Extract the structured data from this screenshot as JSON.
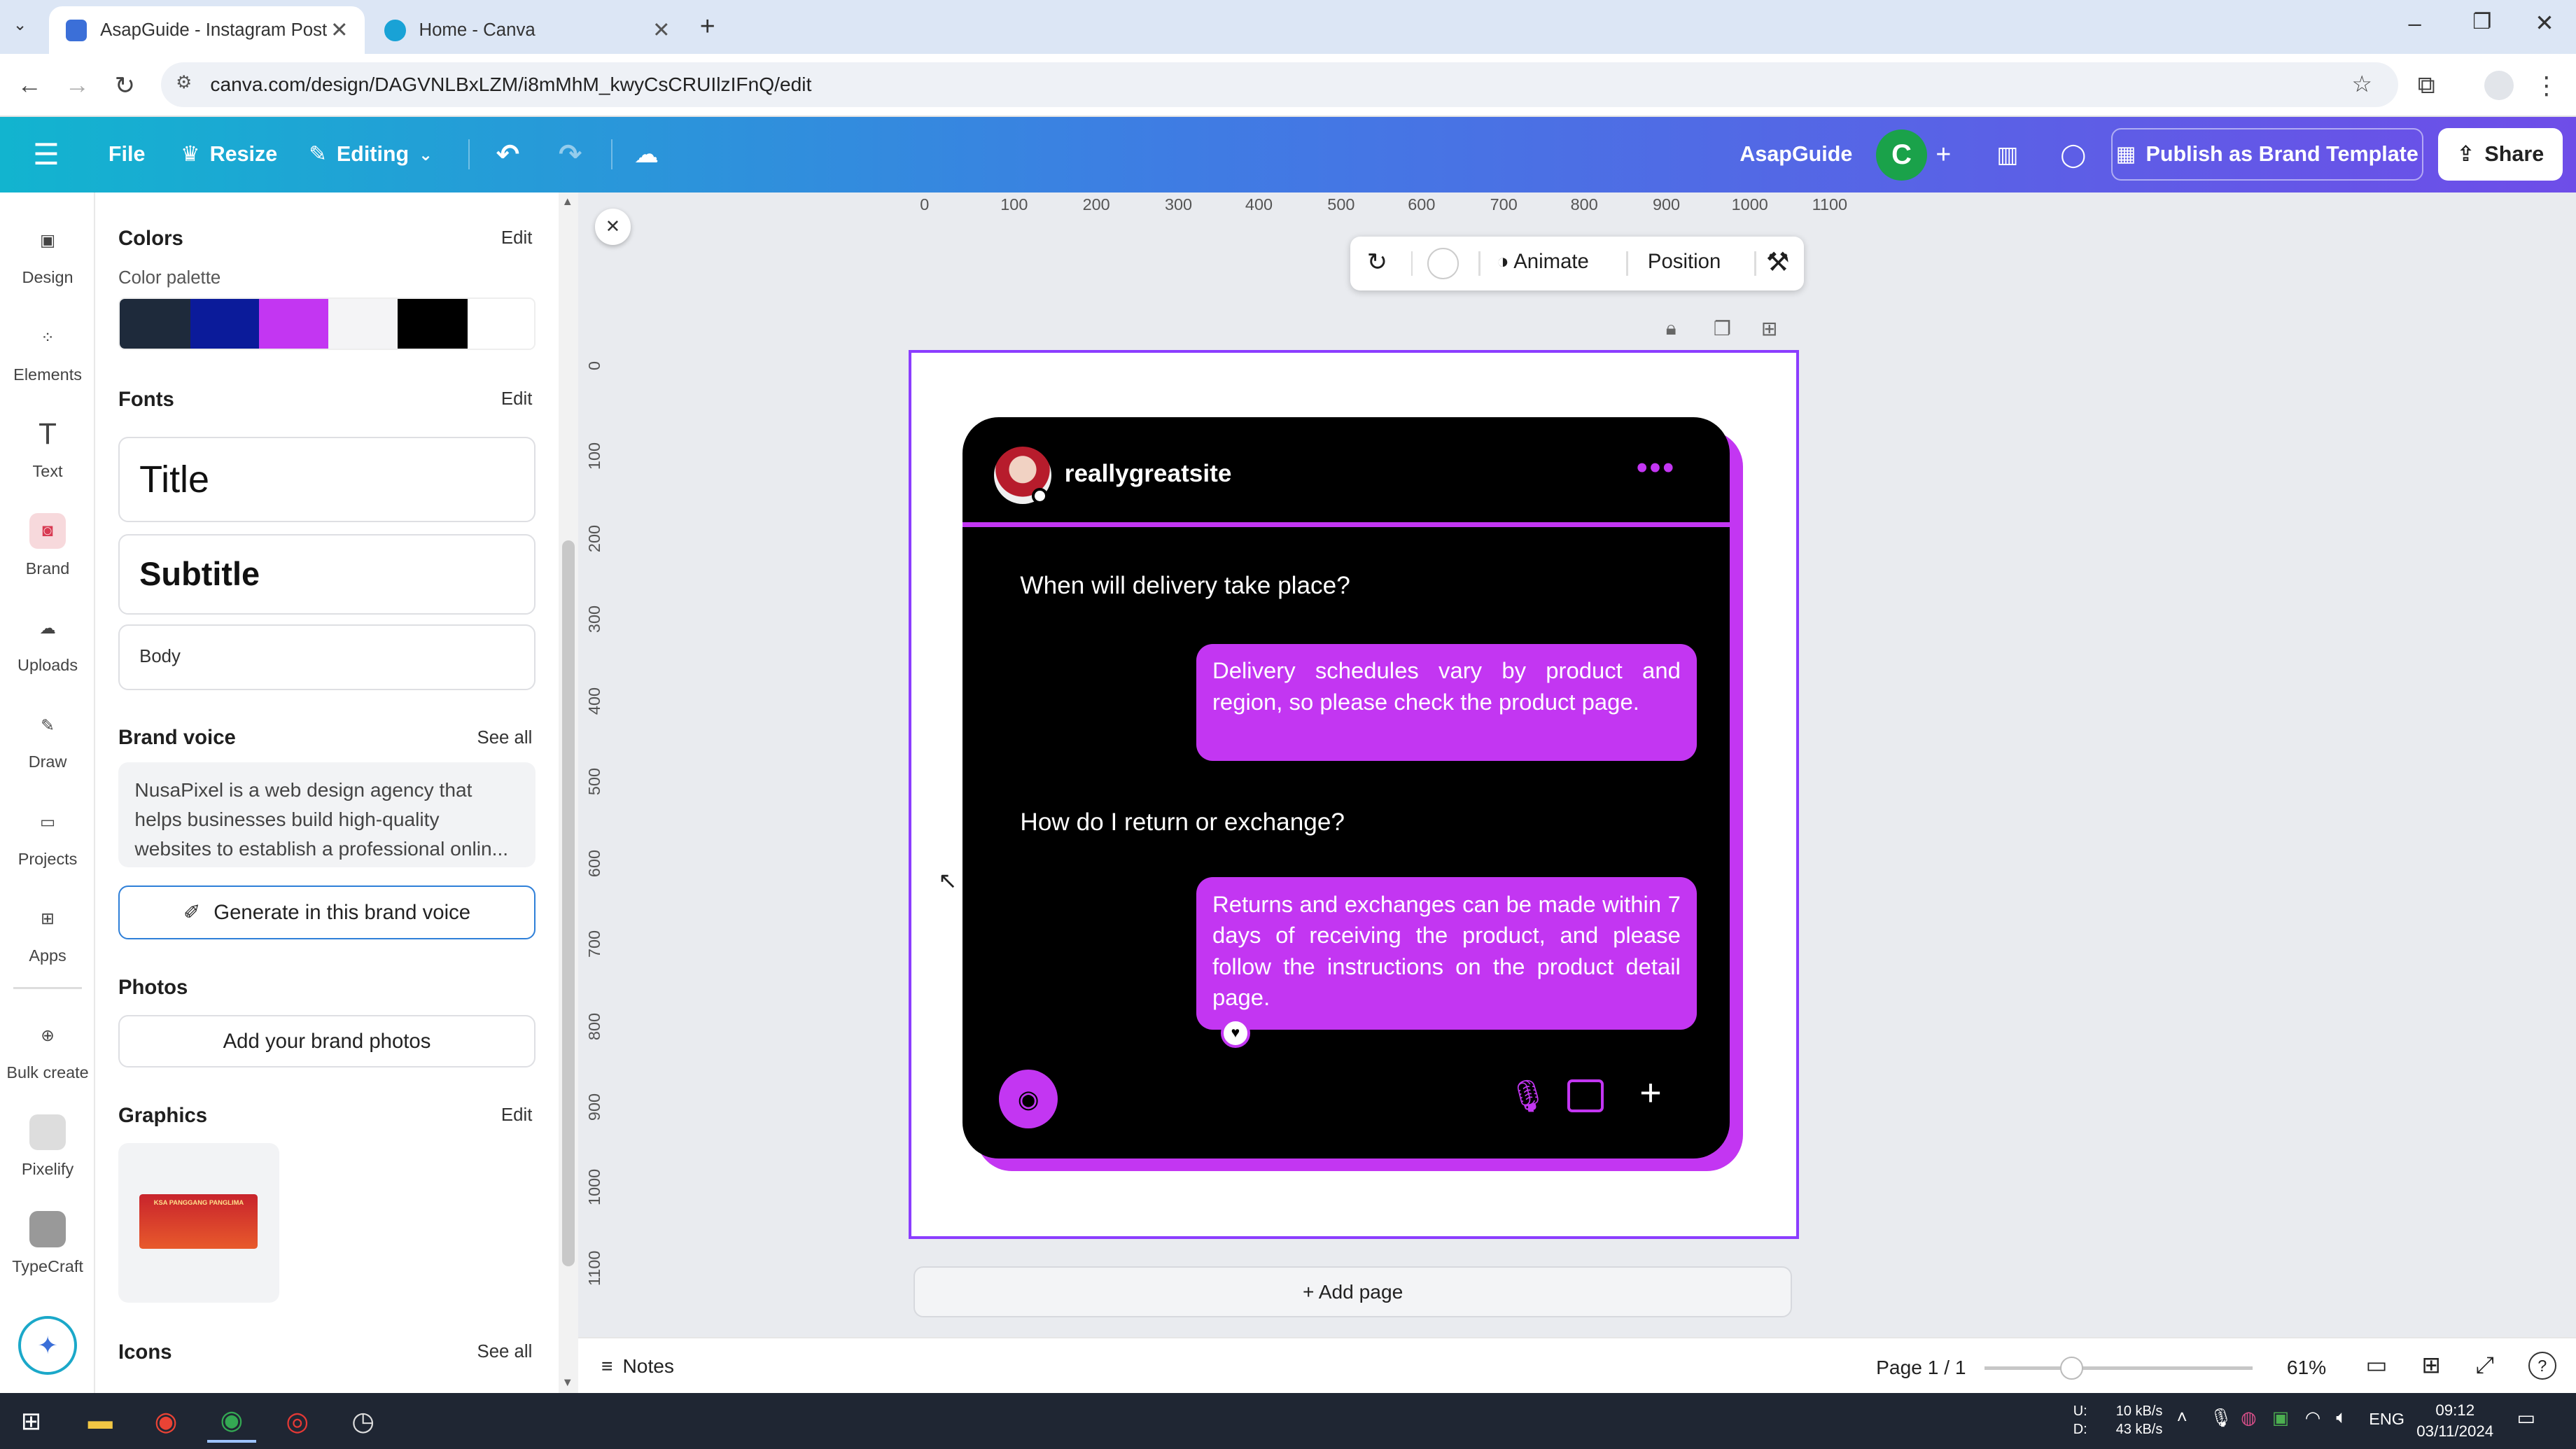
{
  "browser": {
    "tabs": [
      {
        "title": "AsapGuide - Instagram Post",
        "active": true
      },
      {
        "title": "Home - Canva",
        "active": false
      }
    ],
    "url": "canva.com/design/DAGVNLBxLZM/i8mMhM_kwyCsCRUIlzIFnQ/edit"
  },
  "header": {
    "file": "File",
    "resize": "Resize",
    "editing": "Editing",
    "team": "AsapGuide",
    "avatar_letter": "C",
    "publish": "Publish as Brand Template",
    "share": "Share"
  },
  "rail": [
    "Design",
    "Elements",
    "Text",
    "Brand",
    "Uploads",
    "Draw",
    "Projects",
    "Apps",
    "Bulk create",
    "Pixelify",
    "TypeCraft"
  ],
  "panel": {
    "colors_title": "Colors",
    "edit": "Edit",
    "palette_label": "Color palette",
    "palette": [
      "#1e2a3b",
      "#0b1b9a",
      "#c336f2",
      "#f4f4f6",
      "#000000",
      "#ffffff"
    ],
    "fonts_title": "Fonts",
    "font_title": "Title",
    "font_subtitle": "Subtitle",
    "font_body": "Body",
    "brand_voice_title": "Brand voice",
    "see_all": "See all",
    "brand_voice_text": "NusaPixel is a web design agency that helps businesses build high-quality websites to establish a professional onlin...",
    "generate": "Generate in this brand voice",
    "photos_title": "Photos",
    "add_photos": "Add your brand photos",
    "graphics_title": "Graphics",
    "graphic_text": "KSA PANGGANG PANGLIMA",
    "icons_title": "Icons"
  },
  "rulers": {
    "h": [
      "0",
      "100",
      "200",
      "300",
      "400",
      "500",
      "600",
      "700",
      "800",
      "900",
      "1000",
      "1100"
    ],
    "v": [
      "0",
      "100",
      "200",
      "300",
      "400",
      "500",
      "600",
      "700",
      "800",
      "900",
      "1000",
      "1100"
    ]
  },
  "toolbar": {
    "animate": "Animate",
    "position": "Position"
  },
  "design": {
    "username": "reallygreatsite",
    "q1": "When will delivery take place?",
    "a1": "Delivery schedules vary by product and region, so please check the product page.",
    "q2": "How do I return or exchange?",
    "a2": "Returns and exchanges can be made within 7 days of receiving the product, and please follow the instructions on the product detail page."
  },
  "add_page": "+ Add page",
  "footer": {
    "notes": "Notes",
    "page": "Page 1 / 1",
    "zoom": 0.61,
    "zoom_label": "61%"
  },
  "taskbar": {
    "net_up": "10 kB/s",
    "net_down": "43 kB/s",
    "net_labels": [
      "U:",
      "D:"
    ],
    "lang": "ENG",
    "time": "09:12",
    "date": "03/11/2024"
  },
  "colors": {
    "accent": "#c336f2",
    "canva_purple": "#8b3dff"
  }
}
